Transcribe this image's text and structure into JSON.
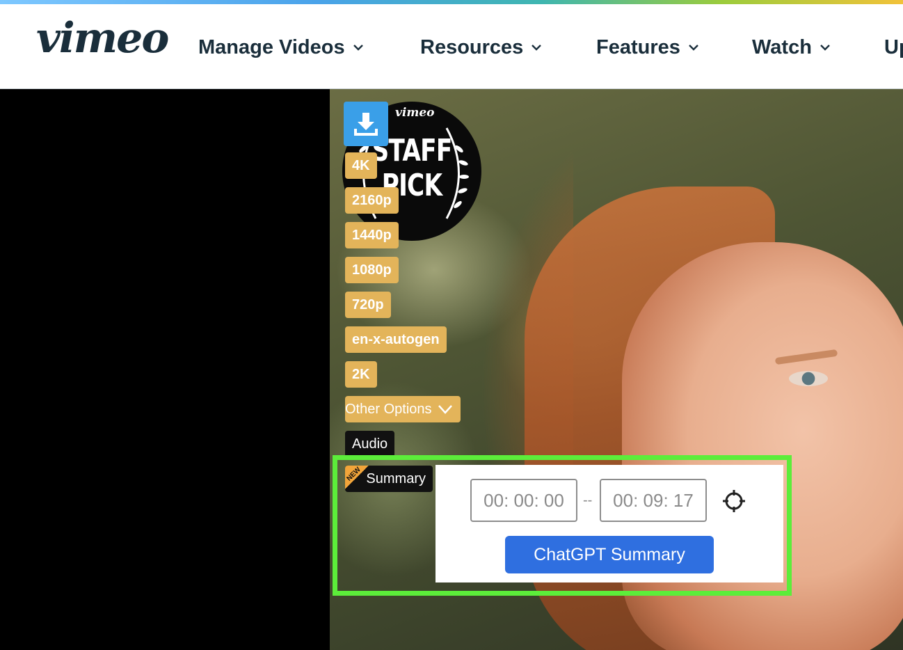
{
  "header": {
    "logo": "vimeo",
    "nav": [
      {
        "label": "Manage Videos"
      },
      {
        "label": "Resources"
      },
      {
        "label": "Features"
      },
      {
        "label": "Watch"
      },
      {
        "label": "Up"
      }
    ]
  },
  "video": {
    "badge": {
      "brand": "vimeo",
      "line1": "STAFF",
      "line2": "PICK"
    }
  },
  "downloader": {
    "download_icon": "download-icon",
    "resolutions": [
      "4K",
      "2160p",
      "1440p",
      "1080p",
      "720p",
      "en-x-autogen",
      "2K"
    ],
    "other_options": "Other Options",
    "audio": "Audio",
    "summary": {
      "label": "Summary",
      "new_badge": "NEW"
    },
    "panel": {
      "start_time": "00: 00: 00",
      "separator": "--",
      "end_time": "00: 09: 17",
      "target_icon": "crosshair-icon",
      "button": "ChatGPT Summary"
    }
  },
  "colors": {
    "accent_button": "#2f6fe0",
    "resolution_button": "#e3b45a",
    "highlight_border": "#5ced3a",
    "download_button": "#3a9fe8"
  }
}
